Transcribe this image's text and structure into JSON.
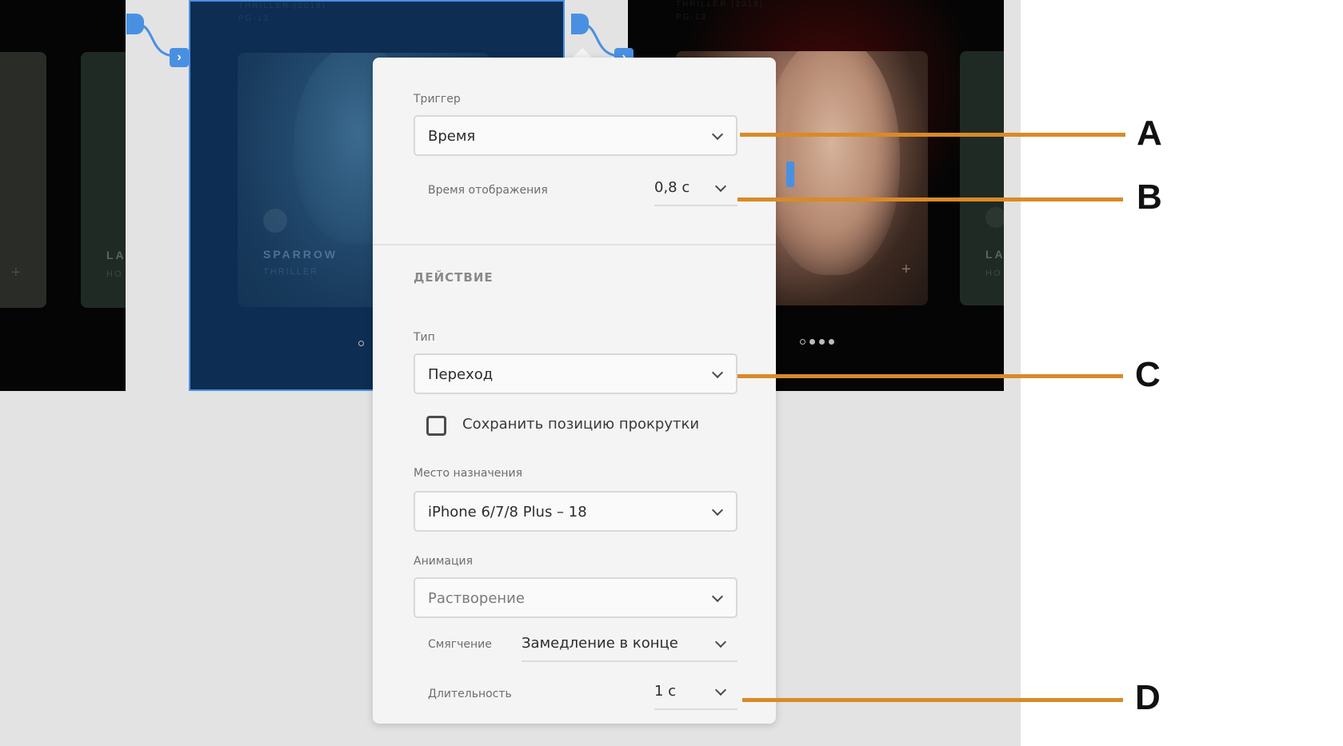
{
  "canvas": {
    "left_artboard": {
      "title_partial": "LA",
      "subtitle_partial": "HO"
    },
    "mid_artboard": {
      "header_title": "THRILLER (2018)",
      "header_rating": "PG-13",
      "card_title": "SPARROW",
      "card_genre": "THRILLER"
    },
    "right_artboard": {
      "header_title": "THRILLER (2018)",
      "header_rating": "PG-13",
      "card_title_partial": "LA",
      "card_genre_partial": "HO"
    },
    "plus_symbol": "+",
    "wire_arrow_glyph": "›"
  },
  "popover": {
    "trigger": {
      "label": "Триггер",
      "value": "Время"
    },
    "display_time": {
      "label": "Время отображения",
      "value": "0,8 с"
    },
    "action_section": {
      "heading": "ДЕЙСТВИЕ"
    },
    "type": {
      "label": "Тип",
      "value": "Переход"
    },
    "scroll_checkbox": {
      "label": "Сохранить позицию прокрутки",
      "checked": false
    },
    "destination": {
      "label": "Место назначения",
      "value": "iPhone 6/7/8 Plus – 18"
    },
    "animation": {
      "label": "Анимация",
      "value": "Растворение"
    },
    "easing": {
      "label": "Смягчение",
      "value": "Замедление в конце"
    },
    "duration": {
      "label": "Длительность",
      "value": "1 с"
    }
  },
  "callouts": {
    "a": "A",
    "b": "B",
    "c": "C",
    "d": "D"
  },
  "colors": {
    "accent_blue": "#4a90e2",
    "callout_orange": "#d98a28",
    "popover_bg": "#f4f4f4"
  }
}
